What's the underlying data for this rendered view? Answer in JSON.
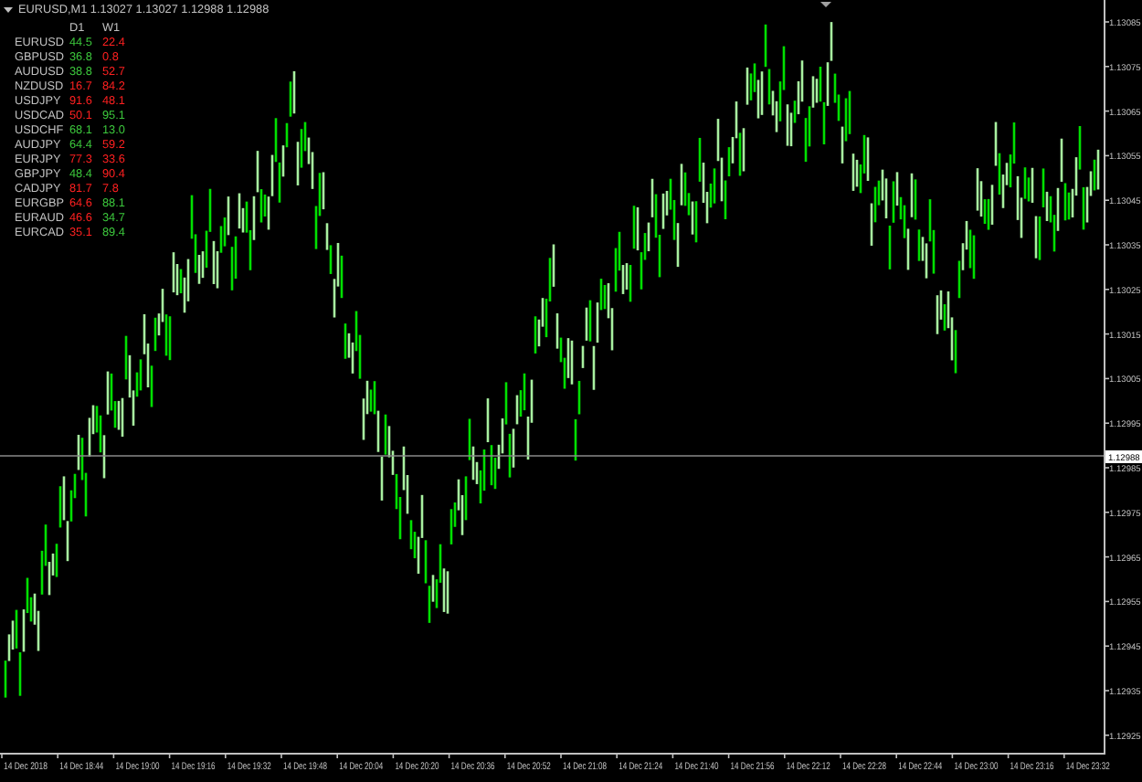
{
  "window": {
    "title": "EURUSD,M1 1.13027 1.13027 1.12988 1.12988"
  },
  "strength_table": {
    "columns": [
      "D1",
      "W1"
    ],
    "rows": [
      {
        "symbol": "EURUSD",
        "d1": {
          "value": "44.5",
          "color": "#3cc83c"
        },
        "w1": {
          "value": "22.4",
          "color": "#ff2020"
        }
      },
      {
        "symbol": "GBPUSD",
        "d1": {
          "value": "36.8",
          "color": "#3cc83c"
        },
        "w1": {
          "value": "0.8",
          "color": "#ff2020"
        }
      },
      {
        "symbol": "AUDUSD",
        "d1": {
          "value": "38.8",
          "color": "#3cc83c"
        },
        "w1": {
          "value": "52.7",
          "color": "#ff2020"
        }
      },
      {
        "symbol": "NZDUSD",
        "d1": {
          "value": "16.7",
          "color": "#ff2020"
        },
        "w1": {
          "value": "84.2",
          "color": "#ff2020"
        }
      },
      {
        "symbol": "USDJPY",
        "d1": {
          "value": "91.6",
          "color": "#ff2020"
        },
        "w1": {
          "value": "48.1",
          "color": "#ff2020"
        }
      },
      {
        "symbol": "USDCAD",
        "d1": {
          "value": "50.1",
          "color": "#ff2020"
        },
        "w1": {
          "value": "95.1",
          "color": "#3cc83c"
        }
      },
      {
        "symbol": "USDCHF",
        "d1": {
          "value": "68.1",
          "color": "#3cc83c"
        },
        "w1": {
          "value": "13.0",
          "color": "#3cc83c"
        }
      },
      {
        "symbol": "AUDJPY",
        "d1": {
          "value": "64.4",
          "color": "#3cc83c"
        },
        "w1": {
          "value": "59.2",
          "color": "#ff2020"
        }
      },
      {
        "symbol": "EURJPY",
        "d1": {
          "value": "77.3",
          "color": "#ff2020"
        },
        "w1": {
          "value": "33.6",
          "color": "#ff2020"
        }
      },
      {
        "symbol": "GBPJPY",
        "d1": {
          "value": "48.4",
          "color": "#3cc83c"
        },
        "w1": {
          "value": "90.4",
          "color": "#ff2020"
        }
      },
      {
        "symbol": "CADJPY",
        "d1": {
          "value": "81.7",
          "color": "#ff2020"
        },
        "w1": {
          "value": "7.8",
          "color": "#ff2020"
        }
      },
      {
        "symbol": "EURGBP",
        "d1": {
          "value": "64.6",
          "color": "#ff2020"
        },
        "w1": {
          "value": "88.1",
          "color": "#3cc83c"
        }
      },
      {
        "symbol": "EURAUD",
        "d1": {
          "value": "46.6",
          "color": "#ff2020"
        },
        "w1": {
          "value": "34.7",
          "color": "#3cc83c"
        }
      },
      {
        "symbol": "EURCAD",
        "d1": {
          "value": "35.1",
          "color": "#ff2020"
        },
        "w1": {
          "value": "89.4",
          "color": "#3cc83c"
        }
      }
    ]
  },
  "price_axis": {
    "labels": [
      "1.13085",
      "1.13075",
      "1.13065",
      "1.13055",
      "1.13045",
      "1.13035",
      "1.13025",
      "1.13015",
      "1.13005",
      "1.12995",
      "1.12985",
      "1.12975",
      "1.12965",
      "1.12955",
      "1.12945",
      "1.12935",
      "1.12925"
    ],
    "current_price": "1.12988"
  },
  "time_axis": {
    "labels": [
      "14 Dec 2018",
      "14 Dec 18:44",
      "14 Dec 19:00",
      "14 Dec 19:16",
      "14 Dec 19:32",
      "14 Dec 19:48",
      "14 Dec 20:04",
      "14 Dec 20:20",
      "14 Dec 20:36",
      "14 Dec 20:52",
      "14 Dec 21:08",
      "14 Dec 21:24",
      "14 Dec 21:40",
      "14 Dec 21:56",
      "14 Dec 22:12",
      "14 Dec 22:28",
      "14 Dec 22:44",
      "14 Dec 23:00",
      "14 Dec 23:16",
      "14 Dec 23:32"
    ]
  }
}
